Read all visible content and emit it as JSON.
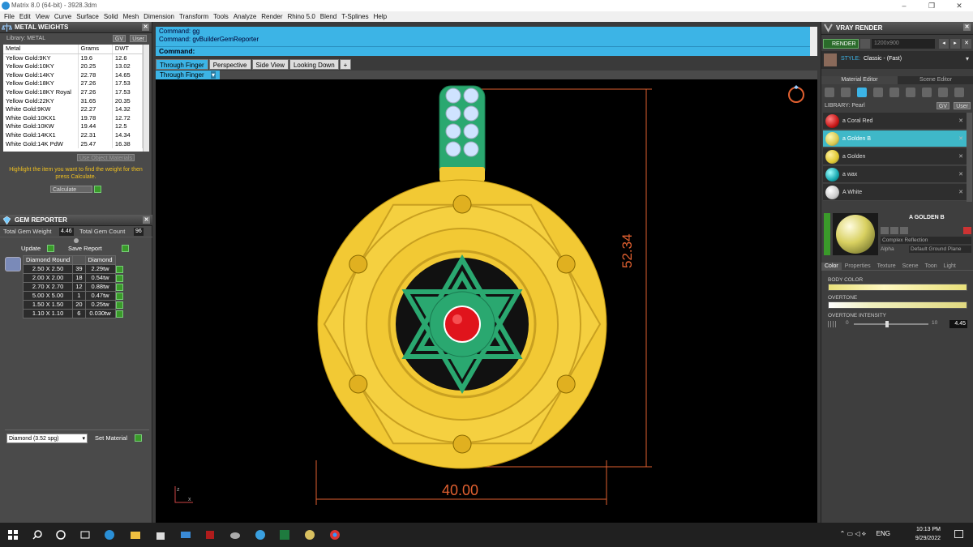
{
  "window": {
    "title": "Matrix 8.0 (64-bit) - 3928.3dm",
    "controls": [
      "–",
      "❐",
      "✕"
    ]
  },
  "menu": [
    "File",
    "Edit",
    "View",
    "Curve",
    "Surface",
    "Solid",
    "Mesh",
    "Dimension",
    "Transform",
    "Tools",
    "Analyze",
    "Render",
    "Rhino 5.0",
    "Blend",
    "T-Splines",
    "Help"
  ],
  "metal_weights": {
    "title": "METAL WEIGHTS",
    "library_label": "Library: METAL",
    "gv": "GV",
    "user": "User",
    "columns": [
      "Metal",
      "Grams",
      "DWT"
    ],
    "rows": [
      [
        "Yellow Gold:9KY",
        "19.6",
        "12.6"
      ],
      [
        "Yellow Gold:10KY",
        "20.25",
        "13.02"
      ],
      [
        "Yellow Gold:14KY",
        "22.78",
        "14.65"
      ],
      [
        "Yellow Gold:18KY",
        "27.26",
        "17.53"
      ],
      [
        "Yellow Gold:18KY Royal",
        "27.26",
        "17.53"
      ],
      [
        "Yellow Gold:22KY",
        "31.65",
        "20.35"
      ],
      [
        "White Gold:9KW",
        "22.27",
        "14.32"
      ],
      [
        "White Gold:10KX1",
        "19.78",
        "12.72"
      ],
      [
        "White Gold:10KW",
        "19.44",
        "12.5"
      ],
      [
        "White Gold:14KX1",
        "22.31",
        "14.34"
      ],
      [
        "White Gold:14K PdW",
        "25.47",
        "16.38"
      ]
    ],
    "use_object_materials": "Use Object Materials",
    "hint": "Highlight the item you want to find the weight for then press Calculate.",
    "calculate": "Calculate"
  },
  "gem_reporter": {
    "title": "GEM REPORTER",
    "total_weight_label": "Total Gem Weight",
    "total_weight": "4.46",
    "total_count_label": "Total Gem Count",
    "total_count": "96",
    "update": "Update",
    "save_report": "Save Report",
    "columns": [
      "Diamond Round",
      "",
      "Diamond"
    ],
    "rows": [
      [
        "2.50 X 2.50",
        "39",
        "2.29tw"
      ],
      [
        "2.00 X 2.00",
        "18",
        "0.54tw"
      ],
      [
        "2.70 X 2.70",
        "12",
        "0.88tw"
      ],
      [
        "5.00 X 5.00",
        "1",
        "0.47tw"
      ],
      [
        "1.50 X 1.50",
        "20",
        "0.25tw"
      ],
      [
        "1.10 X 1.10",
        "6",
        "0.030tw"
      ]
    ],
    "material_select": "Diamond    (3.52 spg)",
    "set_material": "Set Material"
  },
  "command": {
    "history": [
      "Command: gg",
      "Command: gvBuilderGemReporter"
    ],
    "prompt": "Command:"
  },
  "view_tabs": [
    "Through Finger",
    "Perspective",
    "Side View",
    "Looking Down",
    "+"
  ],
  "viewport": {
    "label": "Through Finger",
    "dim_width": "40.00",
    "dim_height": "52.34",
    "colors": {
      "gold": "#f2c934",
      "enamel": "#2aa870",
      "ruby": "#e0141c",
      "diamond": "#cfe3ff",
      "dim": "#e06030"
    }
  },
  "vray": {
    "title": "VRAY RENDER",
    "render": "RENDER",
    "resolution": "1200x900",
    "style_label": "STYLE:",
    "style": "Classic - (Fast)",
    "tabs": [
      "Material Editor",
      "Scene Editor"
    ],
    "library_label": "LIBRARY: Pearl",
    "materials": [
      {
        "name": "a Coral Red",
        "color": "#c81818"
      },
      {
        "name": "a Golden B",
        "color": "#d8c850"
      },
      {
        "name": "a Golden",
        "color": "#e0c830"
      },
      {
        "name": "a wax",
        "color": "#18a8b0"
      },
      {
        "name": "A White",
        "color": "#e8e8e8"
      }
    ],
    "selected_name": "A GOLDEN B",
    "complex_reflection": "Complex Reflection",
    "alpha": "Alpha",
    "ground_plane": "Default Ground Plane",
    "prop_tabs": [
      "Color",
      "Properties",
      "Texture",
      "Scene",
      "Toon",
      "Light"
    ],
    "body_color": "BODY COLOR",
    "overtone": "OVERTONE",
    "overtone_intensity": "OVERTONE INTENSITY",
    "intensity_min": "0",
    "intensity_max": "10",
    "intensity_value": "4.45"
  },
  "taskbar": {
    "lang": "ENG",
    "time": "10:13 PM",
    "date": "9/29/2022"
  }
}
